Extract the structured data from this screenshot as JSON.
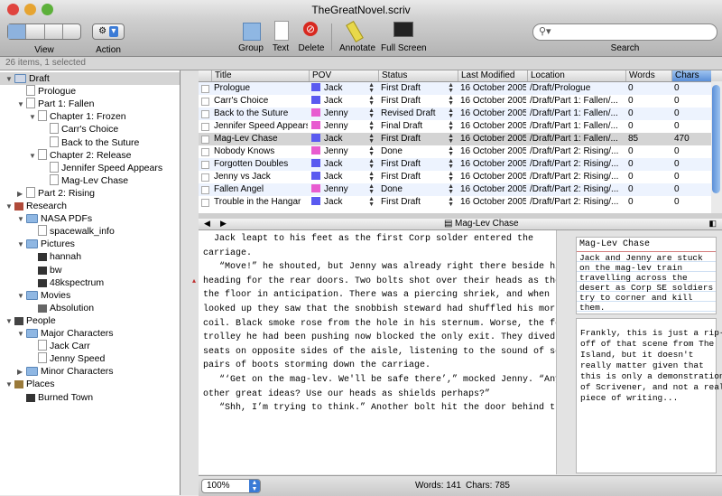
{
  "window": {
    "title": "TheGreatNovel.scriv"
  },
  "toolbar": {
    "view_label": "View",
    "action_label": "Action",
    "group_label": "Group",
    "text_label": "Text",
    "delete_label": "Delete",
    "annotate_label": "Annotate",
    "fullscreen_label": "Full Screen",
    "search_label": "Search",
    "search_placeholder": ""
  },
  "status": {
    "selection": "26 items, 1 selected"
  },
  "binder": [
    {
      "label": "Draft",
      "indent": 0,
      "tri": "▼",
      "icon": "stack",
      "selected": true
    },
    {
      "label": "Prologue",
      "indent": 1,
      "tri": "",
      "icon": "doc"
    },
    {
      "label": "Part 1: Fallen",
      "indent": 1,
      "tri": "▼",
      "icon": "doc"
    },
    {
      "label": "Chapter 1: Frozen",
      "indent": 2,
      "tri": "▼",
      "icon": "doc"
    },
    {
      "label": "Carr's Choice",
      "indent": 3,
      "tri": "",
      "icon": "doc"
    },
    {
      "label": "Back to the Suture",
      "indent": 3,
      "tri": "",
      "icon": "doc"
    },
    {
      "label": "Chapter 2: Release",
      "indent": 2,
      "tri": "▼",
      "icon": "doc"
    },
    {
      "label": "Jennifer Speed Appears",
      "indent": 3,
      "tri": "",
      "icon": "doc"
    },
    {
      "label": "Mag-Lev Chase",
      "indent": 3,
      "tri": "",
      "icon": "doc"
    },
    {
      "label": "Part 2: Rising",
      "indent": 1,
      "tri": "▶",
      "icon": "doc"
    },
    {
      "label": "Research",
      "indent": 0,
      "tri": "▼",
      "icon": "book"
    },
    {
      "label": "NASA PDFs",
      "indent": 1,
      "tri": "▼",
      "icon": "folder"
    },
    {
      "label": "spacewalk_info",
      "indent": 2,
      "tri": "",
      "icon": "doc"
    },
    {
      "label": "Pictures",
      "indent": 1,
      "tri": "▼",
      "icon": "folder"
    },
    {
      "label": "hannah",
      "indent": 2,
      "tri": "",
      "icon": "img"
    },
    {
      "label": "bw",
      "indent": 2,
      "tri": "",
      "icon": "img"
    },
    {
      "label": "48kspectrum",
      "indent": 2,
      "tri": "",
      "icon": "img"
    },
    {
      "label": "Movies",
      "indent": 1,
      "tri": "▼",
      "icon": "folder"
    },
    {
      "label": "Absolution",
      "indent": 2,
      "tri": "",
      "icon": "movie"
    },
    {
      "label": "People",
      "indent": 0,
      "tri": "▼",
      "icon": "person"
    },
    {
      "label": "Major Characters",
      "indent": 1,
      "tri": "▼",
      "icon": "folder"
    },
    {
      "label": "Jack Carr",
      "indent": 2,
      "tri": "",
      "icon": "doc"
    },
    {
      "label": "Jenny Speed",
      "indent": 2,
      "tri": "",
      "icon": "doc"
    },
    {
      "label": "Minor Characters",
      "indent": 1,
      "tri": "▶",
      "icon": "folder"
    },
    {
      "label": "Places",
      "indent": 0,
      "tri": "▼",
      "icon": "globe"
    },
    {
      "label": "Burned Town",
      "indent": 1,
      "tri": "",
      "icon": "img"
    }
  ],
  "outliner": {
    "headers": [
      "Title",
      "POV",
      "Status",
      "Last Modified",
      "Location",
      "Words",
      "Chars"
    ],
    "rows": [
      {
        "title": "Prologue",
        "pov": "Jack",
        "pov_color": "#5a5af0",
        "status": "First Draft",
        "modified": "16 October 2005",
        "location": "/Draft/Prologue",
        "words": "0",
        "chars": "0"
      },
      {
        "title": "Carr's Choice",
        "pov": "Jack",
        "pov_color": "#5a5af0",
        "status": "First Draft",
        "modified": "16 October 2005",
        "location": "/Draft/Part 1: Fallen/...",
        "words": "0",
        "chars": "0"
      },
      {
        "title": "Back to the Suture",
        "pov": "Jenny",
        "pov_color": "#e85cd0",
        "status": "Revised Draft",
        "modified": "16 October 2005",
        "location": "/Draft/Part 1: Fallen/...",
        "words": "0",
        "chars": "0"
      },
      {
        "title": "Jennifer Speed Appears",
        "pov": "Jenny",
        "pov_color": "#e85cd0",
        "status": "Final Draft",
        "modified": "16 October 2005",
        "location": "/Draft/Part 1: Fallen/...",
        "words": "0",
        "chars": "0"
      },
      {
        "title": "Mag-Lev Chase",
        "pov": "Jack",
        "pov_color": "#5a5af0",
        "status": "First Draft",
        "modified": "16 October 2005",
        "location": "/Draft/Part 1: Fallen/...",
        "words": "85",
        "chars": "470",
        "selected": true
      },
      {
        "title": "Nobody Knows",
        "pov": "Jenny",
        "pov_color": "#e85cd0",
        "status": "Done",
        "modified": "16 October 2005",
        "location": "/Draft/Part 2: Rising/...",
        "words": "0",
        "chars": "0"
      },
      {
        "title": "Forgotten Doubles",
        "pov": "Jack",
        "pov_color": "#5a5af0",
        "status": "First Draft",
        "modified": "16 October 2005",
        "location": "/Draft/Part 2: Rising/...",
        "words": "0",
        "chars": "0"
      },
      {
        "title": "Jenny vs Jack",
        "pov": "Jack",
        "pov_color": "#5a5af0",
        "status": "First Draft",
        "modified": "16 October 2005",
        "location": "/Draft/Part 2: Rising/...",
        "words": "0",
        "chars": "0"
      },
      {
        "title": "Fallen Angel",
        "pov": "Jenny",
        "pov_color": "#e85cd0",
        "status": "Done",
        "modified": "16 October 2005",
        "location": "/Draft/Part 2: Rising/...",
        "words": "0",
        "chars": "0"
      },
      {
        "title": "Trouble in the Hangar",
        "pov": "Jack",
        "pov_color": "#5a5af0",
        "status": "First Draft",
        "modified": "16 October 2005",
        "location": "/Draft/Part 2: Rising/...",
        "words": "0",
        "chars": "0"
      }
    ]
  },
  "editor": {
    "doc_title": "Mag-Lev Chase",
    "paragraphs": [
      "  Jack leapt to his feet as the first Corp solder entered the",
      "carriage.",
      "   “Move!” he shouted, but Jenny was already right there beside him",
      "heading for the rear doors. Two bolts shot over their heads as they hit",
      "the floor in anticipation. There was a piercing shriek, and when they",
      "looked up they saw that the snobbish steward had shuffled his mortal",
      "coil. Black smoke rose from the hole in his sternum. Worse, the food",
      "trolley he had been pushing now blocked the only exit. They dived into",
      "seats on opposite sides of the aisle, listening to the sound of several",
      "pairs of boots storming down the carriage.",
      "   “‘Get on the mag-lev. We'll be safe there’,” mocked Jenny. “Any",
      "other great ideas? Use our heads as shields perhaps?”",
      "   “Shh, I’m trying to think.” Another bolt hit the door behind them."
    ]
  },
  "inspector": {
    "card_title": "Mag-Lev Chase",
    "card_synopsis": [
      "Jack and Jenny are stuck",
      "on the mag-lev train",
      "travelling across the",
      "desert as Corp SE soldiers",
      "try to corner and kill",
      "them."
    ],
    "notes": [
      "Frankly, this is just a rip-",
      "off of that scene from The",
      "Island, but it doesn't",
      "really matter given that",
      "this is only a demonstration",
      "of Scrivener, and not a real",
      "piece of writing..."
    ]
  },
  "footer": {
    "zoom": "100%",
    "words": "Words: 141",
    "chars": "Chars: 785"
  }
}
